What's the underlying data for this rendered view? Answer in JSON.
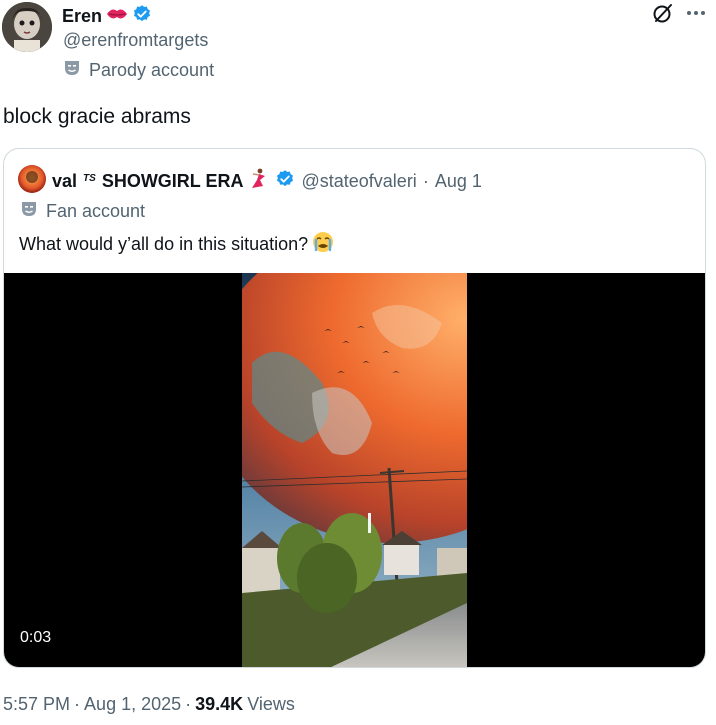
{
  "author": {
    "name": "Eren",
    "handle": "@erenfromtargets",
    "account_label": "Parody account",
    "name_emoji_icon": "kiss-lips-icon",
    "verified_icon": "verified-badge-icon",
    "label_icon": "theater-mask-icon"
  },
  "toolbar": {
    "grok_icon": "grok-slash-icon",
    "more_icon": "more-dots-icon"
  },
  "tweet": {
    "text": "block gracie abrams"
  },
  "quote": {
    "name": "val",
    "name_suffix": "SHOWGIRL ERA",
    "ts_mark": "TS",
    "handle": "@stateofvaleri",
    "separator": "·",
    "date": "Aug 1",
    "account_label": "Fan account",
    "text": "What would y’all do in this situation?",
    "text_emoji_icon": "crying-face-icon",
    "dancer_icon": "dancer-icon",
    "verified_icon": "verified-badge-icon",
    "video": {
      "duration": "0:03"
    }
  },
  "footer": {
    "time": "5:57 PM",
    "separator": "·",
    "date": "Aug 1, 2025",
    "separator2": "·",
    "views_count": "39.4K",
    "views_label": "Views"
  },
  "colors": {
    "text_primary": "#0f1419",
    "text_secondary": "#536471",
    "verified_blue": "#1d9bf0",
    "border": "#cfd9de"
  }
}
